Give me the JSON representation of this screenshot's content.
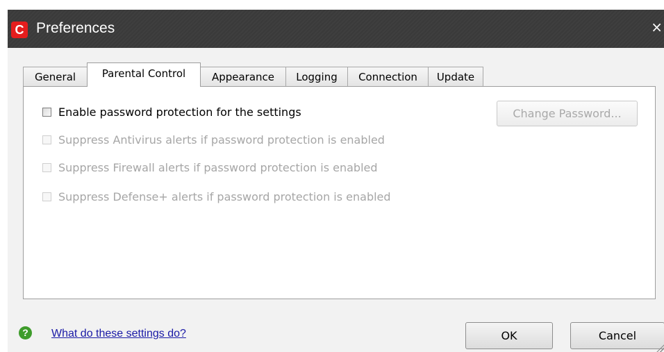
{
  "window": {
    "title": "Preferences",
    "app_icon_letter": "C",
    "close_glyph": "×",
    "icon": "comodo-logo-icon"
  },
  "tabs": [
    {
      "label": "General",
      "active": false
    },
    {
      "label": "Parental Control",
      "active": true
    },
    {
      "label": "Appearance",
      "active": false
    },
    {
      "label": "Logging",
      "active": false
    },
    {
      "label": "Connection",
      "active": false
    },
    {
      "label": "Update",
      "active": false
    }
  ],
  "parental_control": {
    "enable_password": {
      "label": "Enable password protection for the settings",
      "checked": false,
      "enabled": true
    },
    "options": [
      {
        "label": "Suppress Antivirus alerts if password protection is enabled",
        "checked": false,
        "enabled": false
      },
      {
        "label": "Suppress Firewall alerts if password protection is enabled",
        "checked": false,
        "enabled": false
      },
      {
        "label": "Suppress Defense+ alerts if password protection is enabled",
        "checked": false,
        "enabled": false
      }
    ],
    "change_password_label": "Change Password..."
  },
  "footer": {
    "help_glyph": "?",
    "help_link": "What do these settings do?",
    "ok_label": "OK",
    "cancel_label": "Cancel"
  },
  "colors": {
    "titlebar": "#3a3a3a",
    "app_icon": "#e51d1d",
    "help_icon": "#3e9c2b",
    "link": "#1a1aa6",
    "disabled_text": "#a6a6a6"
  }
}
